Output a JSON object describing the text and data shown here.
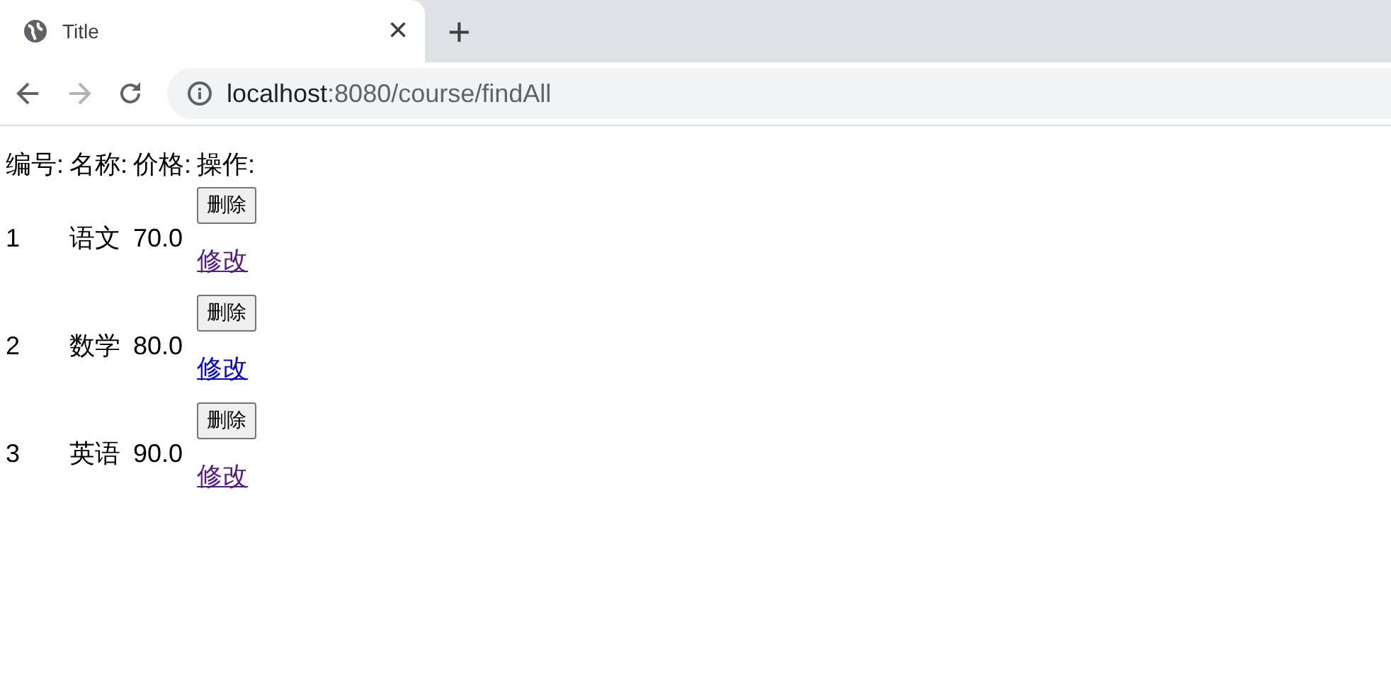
{
  "tab": {
    "title": "Title",
    "close": "×",
    "new_tab": "+"
  },
  "address_bar": {
    "host": "localhost",
    "path": ":8080/course/findAll",
    "forward_disabled": true
  },
  "table": {
    "columns": [
      "编号:",
      "名称:",
      "价格:",
      "操作:"
    ],
    "rows": [
      {
        "id": "1",
        "name": "语文",
        "price": "70.0",
        "delete": "删除",
        "edit": "修改",
        "visited": true
      },
      {
        "id": "2",
        "name": "数学",
        "price": "80.0",
        "delete": "删除",
        "edit": "修改",
        "visited": false
      },
      {
        "id": "3",
        "name": "英语",
        "price": "90.0",
        "delete": "删除",
        "edit": "修改",
        "visited": true
      }
    ]
  }
}
